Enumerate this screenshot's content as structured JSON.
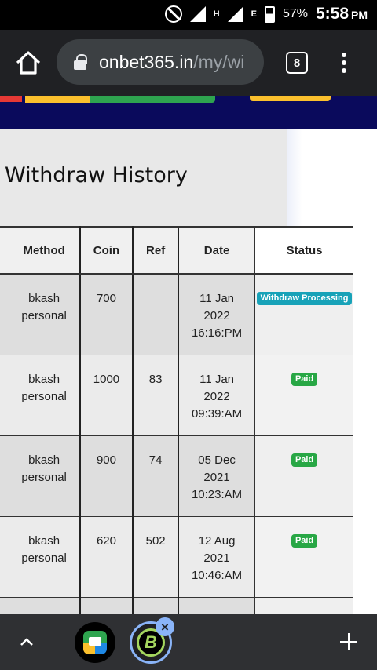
{
  "status_bar": {
    "battery": "57%",
    "time": "5:58",
    "ampm": "PM",
    "net_type": "H",
    "net_type2": "E"
  },
  "browser": {
    "url_host": "onbet365.in",
    "url_path": "/my/wi",
    "tab_count": "8"
  },
  "page": {
    "title": "Withdraw History",
    "columns": [
      "Method",
      "Coin",
      "Ref",
      "Date",
      "Status"
    ],
    "rows": [
      {
        "method_line1": "bkash",
        "method_line2": "personal",
        "coin": "700",
        "ref": "",
        "date_line1": "11 Jan",
        "date_line2": "2022",
        "date_line3": "16:16:PM",
        "status": "Withdraw Processing",
        "status_color": "#17a2b8"
      },
      {
        "method_line1": "bkash",
        "method_line2": "personal",
        "coin": "1000",
        "ref": "83",
        "date_line1": "11 Jan",
        "date_line2": "2022",
        "date_line3": "09:39:AM",
        "status": "Paid",
        "status_color": "#28a745"
      },
      {
        "method_line1": "bkash",
        "method_line2": "personal",
        "coin": "900",
        "ref": "74",
        "date_line1": "05 Dec",
        "date_line2": "2021",
        "date_line3": "10:23:AM",
        "status": "Paid",
        "status_color": "#28a745"
      },
      {
        "method_line1": "bkash",
        "method_line2": "personal",
        "coin": "620",
        "ref": "502",
        "date_line1": "12 Aug",
        "date_line2": "2021",
        "date_line3": "10:46:AM",
        "status": "Paid",
        "status_color": "#28a745"
      }
    ]
  },
  "bottom_bar": {
    "app2_glyph": "B"
  }
}
